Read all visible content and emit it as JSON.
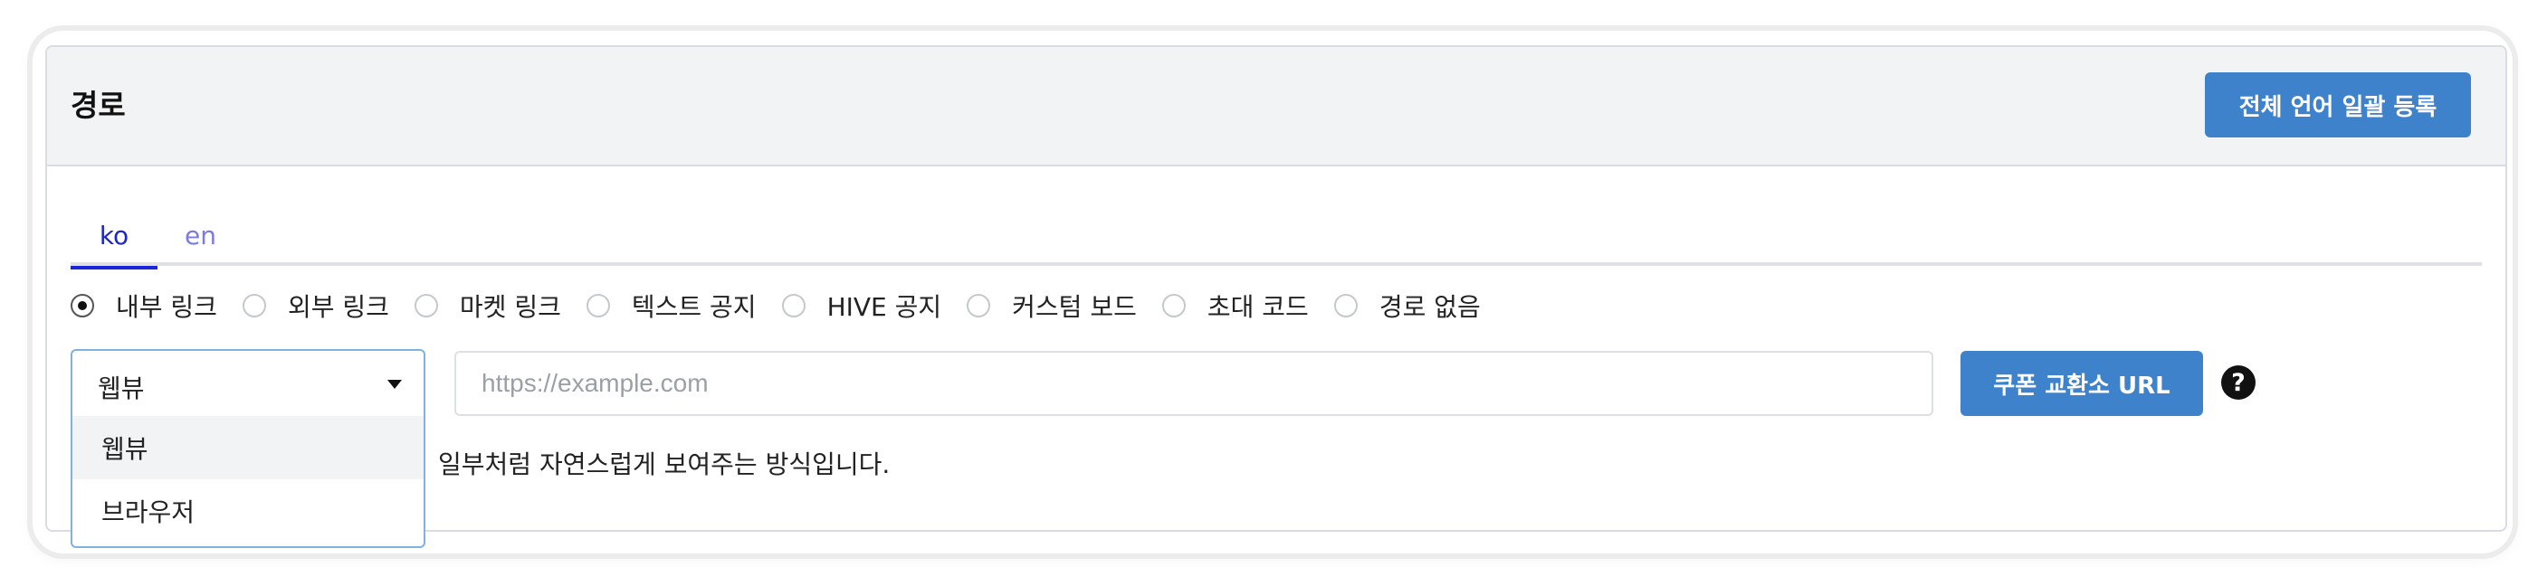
{
  "panel": {
    "title": "경로",
    "bulk_button_label": "전체 언어 일괄 등록"
  },
  "tabs": [
    {
      "label": "ko",
      "active": true
    },
    {
      "label": "en",
      "active": false
    }
  ],
  "route_types": {
    "selected": "내부 링크",
    "options": [
      "내부 링크",
      "외부 링크",
      "마켓 링크",
      "텍스트 공지",
      "HIVE 공지",
      "커스텀 보드",
      "초대 코드",
      "경로 없음"
    ]
  },
  "open_mode_select": {
    "value": "웹뷰",
    "options": [
      "웹뷰",
      "브라우저"
    ]
  },
  "url_input": {
    "value": "",
    "placeholder": "https://example.com"
  },
  "coupon_button_label": "쿠폰 교환소 URL",
  "help_icon": "question-circle-icon",
  "help_text": "일부처럼 자연스럽게 보여주는 방식입니다.",
  "colors": {
    "primary_button": "#3f82cc",
    "active_tab": "#1a24d6",
    "inactive_tab": "#7c7cdc",
    "header_bg": "#f2f3f5"
  }
}
